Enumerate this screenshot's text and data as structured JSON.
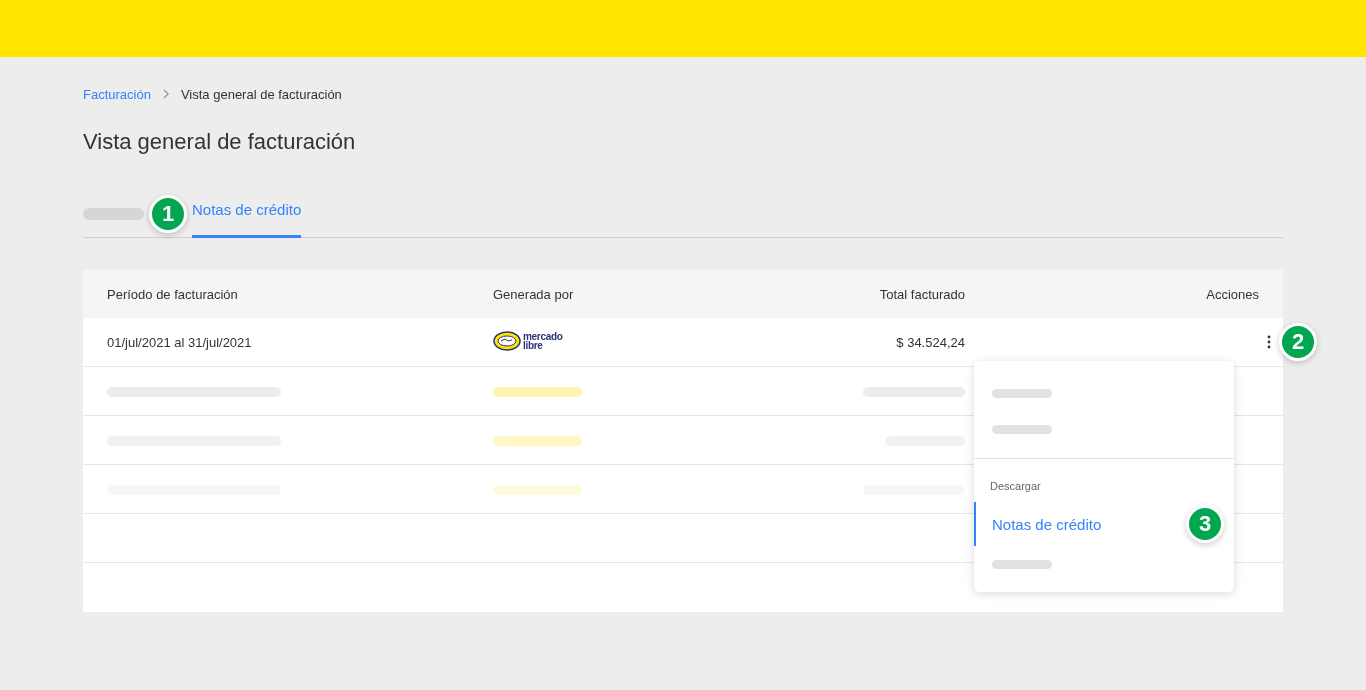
{
  "breadcrumb": [
    {
      "label": "Facturación",
      "kind": "link"
    },
    {
      "label": "Vista general de facturación",
      "kind": "current"
    }
  ],
  "title": "Vista general de facturación",
  "tabs": [
    {
      "kind": "placeholder",
      "selected": false,
      "marker": "1"
    },
    {
      "kind": "tab",
      "label": "Notas de crédito",
      "selected": true
    }
  ],
  "table": {
    "columns": [
      "Período de facturación",
      "Generada por",
      "Total facturado",
      "Acciones"
    ],
    "rows": [
      {
        "kind": "data",
        "period": "01/jul/2021 al 31/jul/2021",
        "logo": [
          "mercado",
          "libre"
        ],
        "total": "$ 34.524,24",
        "marker": "2"
      },
      {
        "kind": "placeholder"
      },
      {
        "kind": "placeholder"
      },
      {
        "kind": "placeholder"
      },
      {
        "kind": "empty"
      },
      {
        "kind": "empty"
      }
    ]
  },
  "menu": {
    "items": [
      {
        "kind": "placeholder"
      },
      {
        "kind": "placeholder"
      },
      {
        "kind": "divider"
      },
      {
        "kind": "section",
        "label": "Descargar"
      },
      {
        "kind": "item",
        "label": "Notas de crédito",
        "selected": true,
        "marker": "3"
      },
      {
        "kind": "placeholder"
      }
    ]
  }
}
